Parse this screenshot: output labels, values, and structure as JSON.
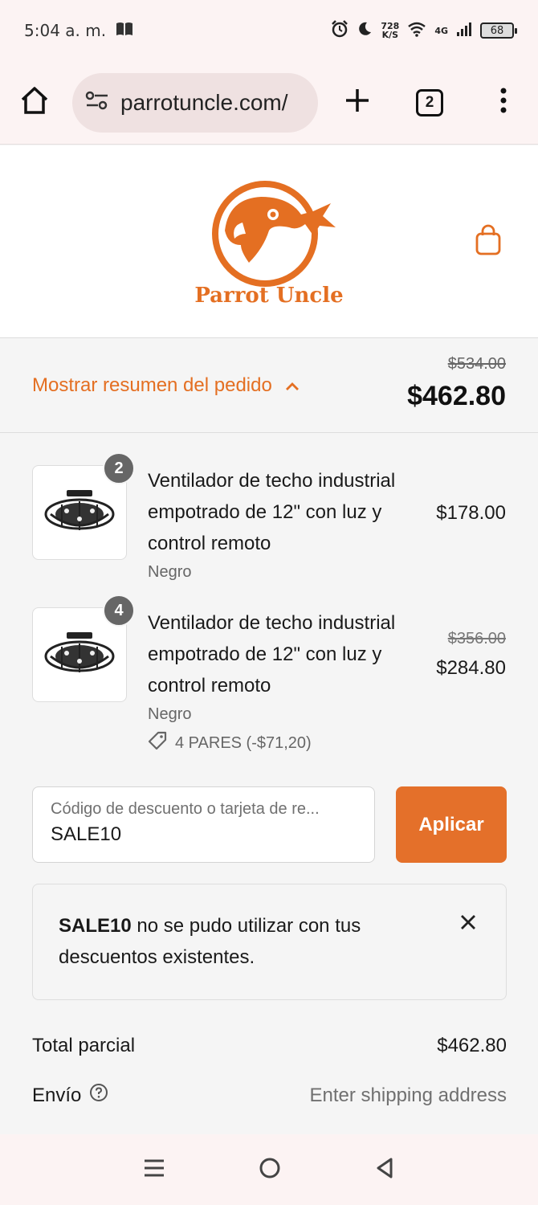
{
  "status_bar": {
    "time": "5:04 a. m.",
    "speed_value": "728",
    "speed_unit": "K/S",
    "network": "4G",
    "battery": "68"
  },
  "browser": {
    "url": "parrotuncle.com/",
    "tab_count": "2"
  },
  "store": {
    "name": "Parrot Uncle",
    "brand_color": "#e46f22"
  },
  "summary": {
    "toggle_label": "Mostrar resumen del pedido",
    "original_total": "$534.00",
    "total": "$462.80"
  },
  "products": [
    {
      "quantity": "2",
      "name": "Ventilador de techo industrial empotrado de 12\" con luz y control remoto",
      "variant": "Negro",
      "price": "$178.00"
    },
    {
      "quantity": "4",
      "name": "Ventilador de techo industrial empotrado de 12\" con luz y control remoto",
      "variant": "Negro",
      "original_price": "$356.00",
      "price": "$284.80",
      "discount": "4 PARES (-$71,20)"
    }
  ],
  "discount_code": {
    "placeholder": "Código de descuento o tarjeta de re...",
    "value": "SALE10",
    "apply_label": "Aplicar"
  },
  "error": {
    "code": "SALE10",
    "message": " no se pudo utilizar con tus descuentos existentes."
  },
  "totals": {
    "subtotal_label": "Total parcial",
    "subtotal_value": "$462.80",
    "shipping_label": "Envío",
    "shipping_value": "Enter shipping address"
  }
}
